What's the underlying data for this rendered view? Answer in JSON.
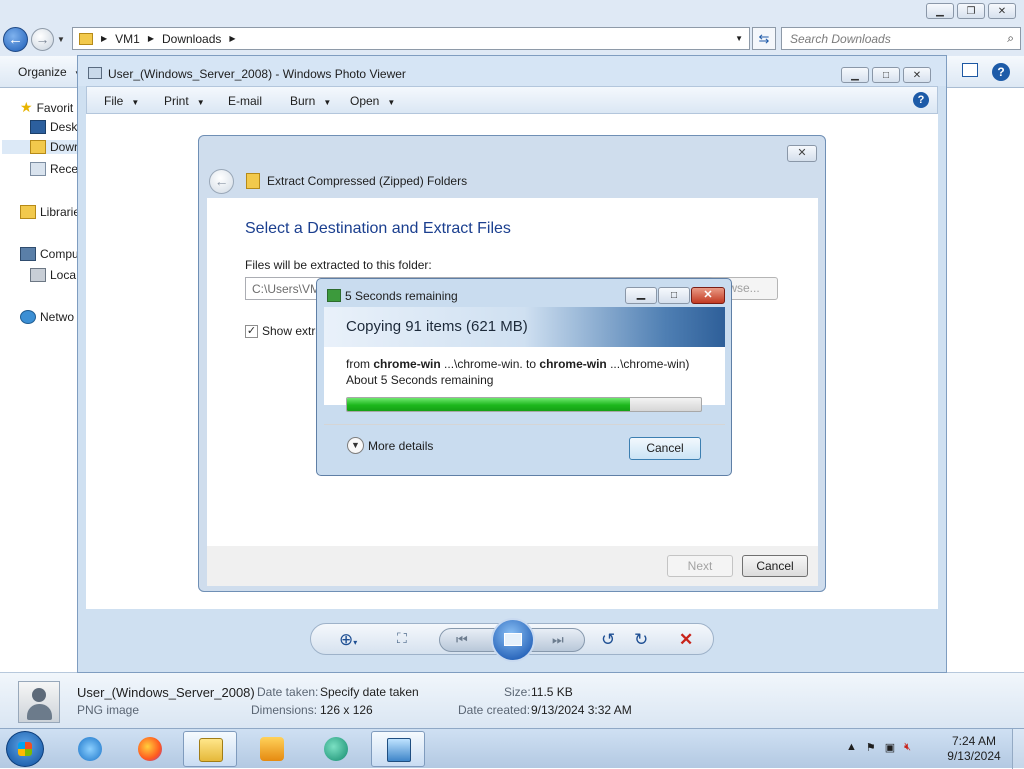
{
  "explorer": {
    "breadcrumb": [
      "VM1",
      "Downloads"
    ],
    "search_placeholder": "Search Downloads",
    "organize_label": "Organize",
    "nav_items": [
      "Favorit",
      "Desk",
      "Dowr",
      "Rece",
      "Librarie",
      "Compu",
      "Loca",
      "Netwo"
    ],
    "details": {
      "file_name": "User_(Windows_Server_2008)",
      "file_type": "PNG image",
      "date_taken_label": "Date taken:",
      "date_taken_value": "Specify date taken",
      "dimensions_label": "Dimensions:",
      "dimensions_value": "126 x 126",
      "size_label": "Size:",
      "size_value": "11.5 KB",
      "date_created_label": "Date created:",
      "date_created_value": "9/13/2024 3:32 AM"
    }
  },
  "photo_viewer": {
    "title": "User_(Windows_Server_2008) - Windows Photo Viewer",
    "menu": [
      "File",
      "Print",
      "E-mail",
      "Burn",
      "Open"
    ]
  },
  "extract_dialog": {
    "title": "Extract Compressed (Zipped) Folders",
    "heading": "Select a Destination and Extract Files",
    "folder_label": "Files will be extracted to this folder:",
    "path_value": "C:\\Users\\VM",
    "browse_label": "wse...",
    "checkbox_label": "Show extra",
    "checkbox_checked": true,
    "next_label": "Next",
    "cancel_label": "Cancel"
  },
  "copy_dialog": {
    "title": "5 Seconds remaining",
    "heading": "Copying 91 items (621 MB)",
    "from_prefix": "from ",
    "from_src": "chrome-win",
    "from_src_path": " ...\\chrome-win. to ",
    "from_dst": "chrome-win",
    "from_dst_path": " ...\\chrome-win)",
    "remaining": "About 5 Seconds remaining",
    "progress_percent": 80,
    "more_details": "More details",
    "cancel_label": "Cancel"
  },
  "taskbar": {
    "time": "7:24 AM",
    "date": "9/13/2024"
  },
  "colors": {
    "progress": "#1db71d",
    "accent": "#1b3f8f"
  }
}
